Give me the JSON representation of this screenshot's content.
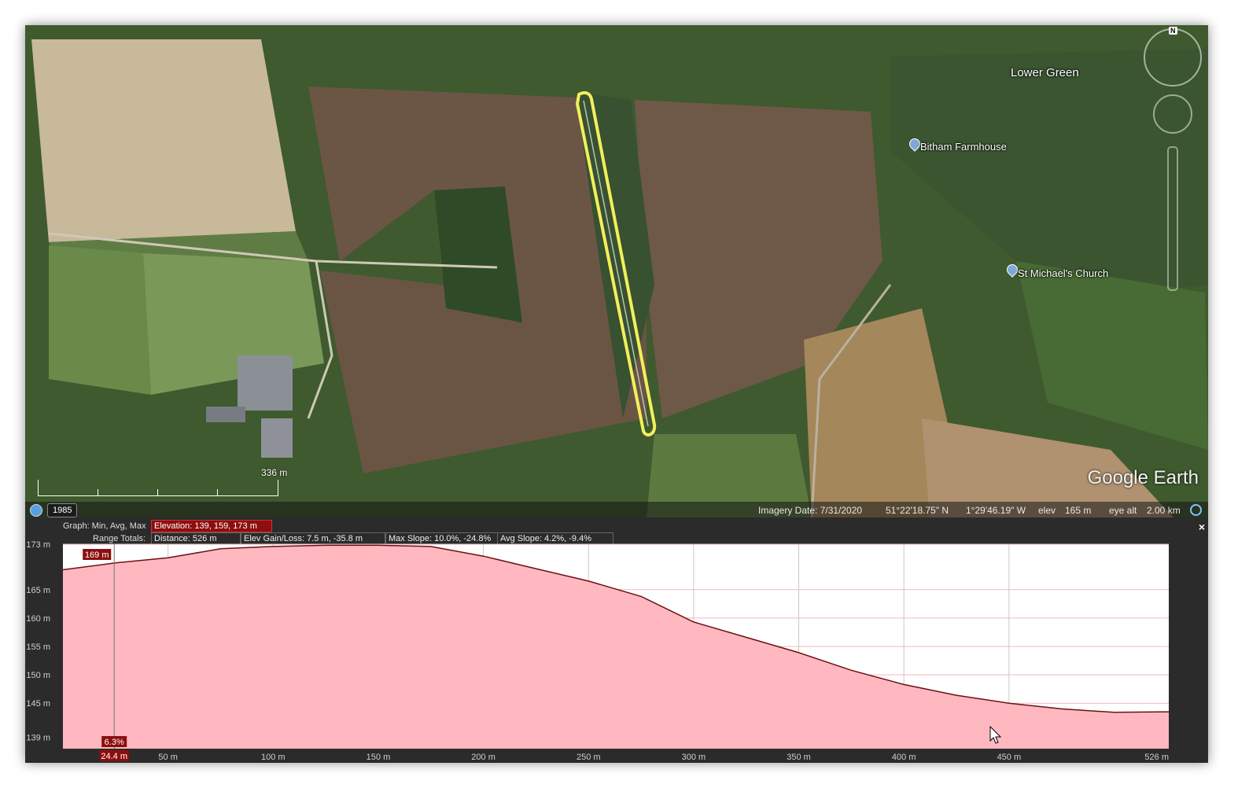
{
  "map": {
    "labels": {
      "lower_green": "Lower Green",
      "bitham_farmhouse": "Bitham Farmhouse",
      "st_michaels_church": "St Michael's Church"
    },
    "scale_label": "336 m",
    "logo": "Google Earth",
    "compass_label": "N",
    "status": {
      "year": "1985",
      "imagery_date": "Imagery Date: 7/31/2020",
      "latitude": "51°22'18.75\" N",
      "longitude": "1°29'46.19\" W",
      "elev_label": "elev",
      "elev_value": "165 m",
      "eye_alt_label": "eye alt",
      "eye_alt_value": "2.00 km"
    }
  },
  "profile": {
    "graph_label": "Graph: Min, Avg, Max",
    "elevation": "Elevation: 139, 159, 173 m",
    "range_totals_label": "Range Totals:",
    "distance": "Distance: 526 m",
    "elev_gain_loss": "Elev Gain/Loss: 7.5 m, -35.8 m",
    "max_slope": "Max Slope: 10.0%, -24.8%",
    "avg_slope": "Avg Slope: 4.2%, -9.4%",
    "close_label": "×",
    "cursor": {
      "elevation": "169 m",
      "slope": "6.3%",
      "distance": "24.4 m"
    }
  },
  "colors": {
    "accent_red": "#8c0e0e",
    "track_yellow": "#f3ef5c",
    "fill_pink": "#ffb8c0"
  },
  "chart_data": {
    "type": "area",
    "xlabel": "",
    "ylabel": "",
    "xlim": [
      0,
      526
    ],
    "ylim": [
      137,
      173
    ],
    "y_ticks": [
      "173 m",
      "165 m",
      "160 m",
      "155 m",
      "150 m",
      "145 m",
      "139 m"
    ],
    "x_ticks": [
      "50 m",
      "100 m",
      "150 m",
      "200 m",
      "250 m",
      "300 m",
      "350 m",
      "400 m",
      "450 m",
      "526 m"
    ],
    "series": [
      {
        "x": [
          0,
          25,
          50,
          75,
          100,
          125,
          150,
          175,
          200,
          225,
          250,
          275,
          300,
          325,
          350,
          375,
          400,
          425,
          450,
          475,
          500,
          526
        ],
        "y": [
          168.5,
          169.7,
          170.6,
          172.2,
          172.6,
          172.8,
          172.8,
          172.6,
          170.9,
          168.7,
          166.5,
          163.8,
          159.3,
          156.6,
          153.9,
          150.8,
          148.3,
          146.4,
          145.0,
          144.0,
          143.4,
          143.5
        ]
      }
    ]
  }
}
